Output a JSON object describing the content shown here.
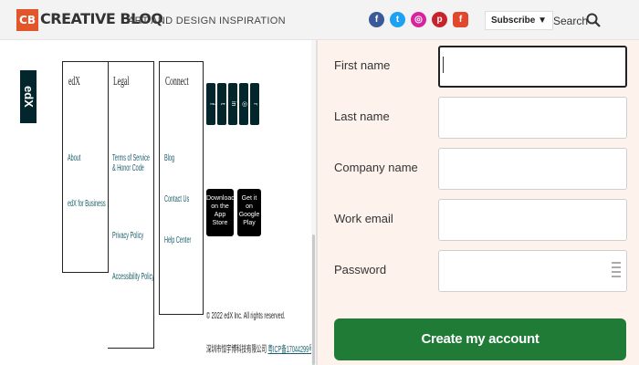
{
  "header": {
    "logo_mark": "CB",
    "logo_text": "CREATIVE BLOQ",
    "tagline": "ART AND DESIGN INSPIRATION",
    "social": [
      {
        "name": "facebook-icon",
        "glyph": "f",
        "color": "#3b5998"
      },
      {
        "name": "twitter-icon",
        "glyph": "t",
        "color": "#1da1f2"
      },
      {
        "name": "instagram-icon",
        "glyph": "◎",
        "color": "#d6249f"
      },
      {
        "name": "pinterest-icon",
        "glyph": "p",
        "color": "#c8232c"
      },
      {
        "name": "flipboard-icon",
        "glyph": "f",
        "color": "#e0472c"
      }
    ],
    "subscribe_label": "Subscribe ▼",
    "search_label": "Search"
  },
  "footer": {
    "logo": "edX",
    "columns": [
      {
        "heading": "edX",
        "links": [
          "About",
          "edX for Business"
        ]
      },
      {
        "heading": "Legal",
        "links": [
          "Terms of Service & Honor Code",
          "Privacy Policy",
          "Accessibility Policy"
        ]
      },
      {
        "heading": "Connect",
        "links": [
          "Blog",
          "Contact Us",
          "Help Center"
        ]
      }
    ],
    "social_icons": [
      "facebook-icon",
      "twitter-icon",
      "linkedin-icon",
      "instagram-icon",
      "reddit-icon"
    ],
    "apps": [
      {
        "name": "app-store-badge",
        "label": "Download on the App Store"
      },
      {
        "name": "google-play-badge",
        "label": "Get it on Google Play"
      }
    ],
    "copyright": "© 2022 edX Inc. All rights reserved.",
    "icp_text": "深圳市恒宇博科技有限公司",
    "icp_link": "粤ICP备17044299号-2"
  },
  "form": {
    "fields": [
      {
        "label": "First name",
        "value": ""
      },
      {
        "label": "Last name",
        "value": ""
      },
      {
        "label": "Company name",
        "value": ""
      },
      {
        "label": "Work email",
        "value": ""
      },
      {
        "label": "Password",
        "value": ""
      }
    ],
    "submit_label": "Create my account",
    "accent": "#1f7b36"
  }
}
